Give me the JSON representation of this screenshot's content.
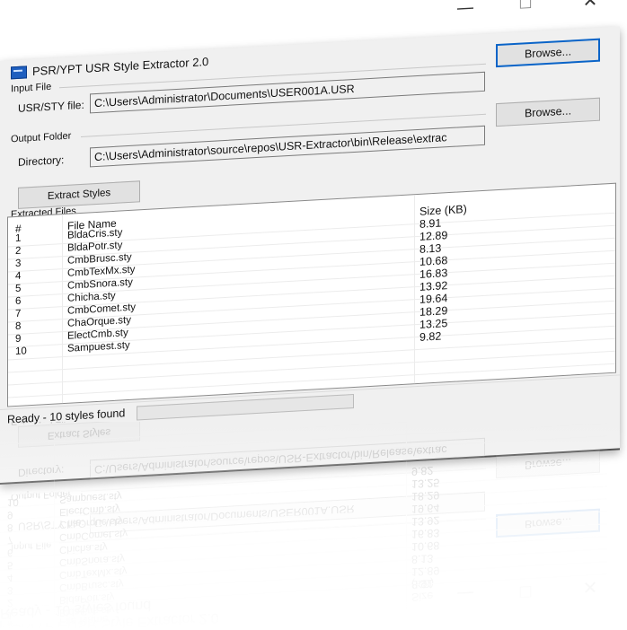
{
  "window": {
    "title": "PSR/YPT USR Style Extractor 2.0",
    "controls": {
      "minimize": "—",
      "maximize": "☐",
      "close": "✕"
    }
  },
  "input_group": {
    "label": "Input File",
    "field_label": "USR/STY file:",
    "value": "C:\\Users\\Administrator\\Documents\\USER001A.USR",
    "browse_label": "Browse..."
  },
  "output_group": {
    "label": "Output Folder",
    "field_label": "Directory:",
    "value": "C:\\Users\\Administrator\\source\\repos\\USR-Extractor\\bin\\Release\\extrac",
    "browse_label": "Browse..."
  },
  "extract_button": "Extract Styles",
  "files_group": {
    "label": "Extracted Files",
    "columns": [
      "#",
      "File Name",
      "Size (KB)"
    ],
    "rows": [
      {
        "num": "1",
        "name": "BldaCris.sty",
        "size": "8.91"
      },
      {
        "num": "2",
        "name": "BldaPotr.sty",
        "size": "12.89"
      },
      {
        "num": "3",
        "name": "CmbBrusc.sty",
        "size": "8.13"
      },
      {
        "num": "4",
        "name": "CmbTexMx.sty",
        "size": "10.68"
      },
      {
        "num": "5",
        "name": "CmbSnora.sty",
        "size": "16.83"
      },
      {
        "num": "6",
        "name": "Chicha.sty",
        "size": "13.92"
      },
      {
        "num": "7",
        "name": "CmbComet.sty",
        "size": "19.64"
      },
      {
        "num": "8",
        "name": "ChaOrque.sty",
        "size": "18.29"
      },
      {
        "num": "9",
        "name": "ElectCmb.sty",
        "size": "13.25"
      },
      {
        "num": "10",
        "name": "Sampuest.sty",
        "size": "9.82"
      }
    ]
  },
  "status": {
    "text": "Ready - 10 styles found",
    "progress": 0
  }
}
